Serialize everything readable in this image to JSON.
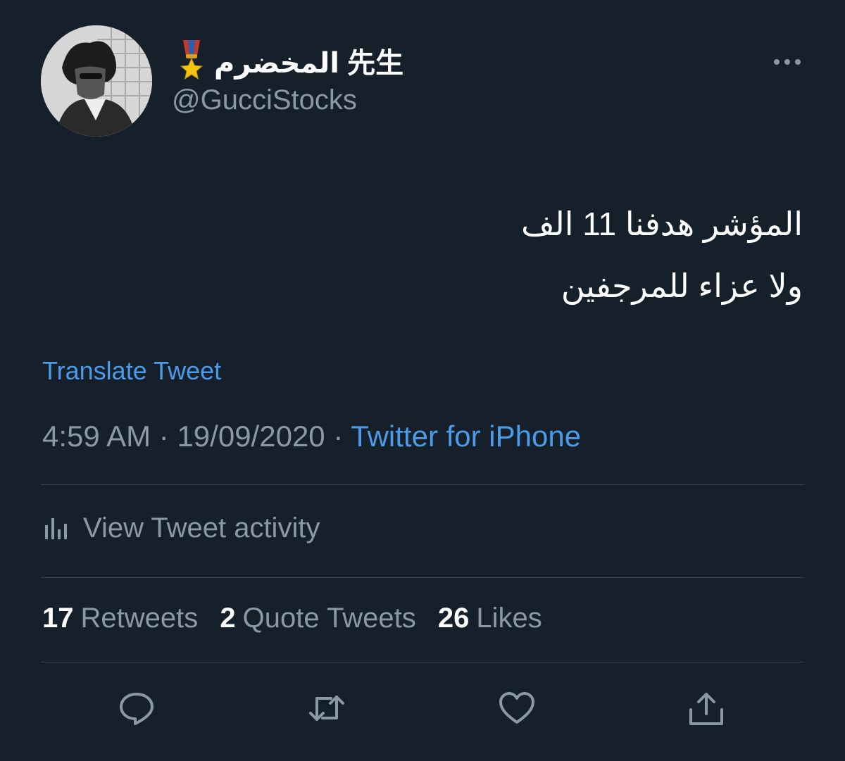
{
  "author": {
    "display_name": "المخضرم 先生",
    "handle": "@GucciStocks",
    "avatar_icon": "avatar-photo",
    "badge_icon": "military-medal-emoji"
  },
  "tweet": {
    "lines": [
      "المؤشر هدفنا 11 الف",
      "ولا عزاء للمرجفين"
    ],
    "translate_label": "Translate Tweet",
    "time": "4:59 AM",
    "date": "19/09/2020",
    "separator": "·",
    "source": "Twitter for iPhone"
  },
  "activity": {
    "label": "View Tweet activity",
    "icon": "bar-chart-icon"
  },
  "stats": {
    "retweets": {
      "count": "17",
      "label": "Retweets"
    },
    "quotes": {
      "count": "2",
      "label": "Quote Tweets"
    },
    "likes": {
      "count": "26",
      "label": "Likes"
    }
  },
  "actions": [
    "reply-icon",
    "retweet-icon",
    "like-icon",
    "share-icon"
  ],
  "colors": {
    "background": "#15202b",
    "text_primary": "#ffffff",
    "text_secondary": "#8b98a5",
    "link": "#4c9be8",
    "divider": "#38444d"
  }
}
